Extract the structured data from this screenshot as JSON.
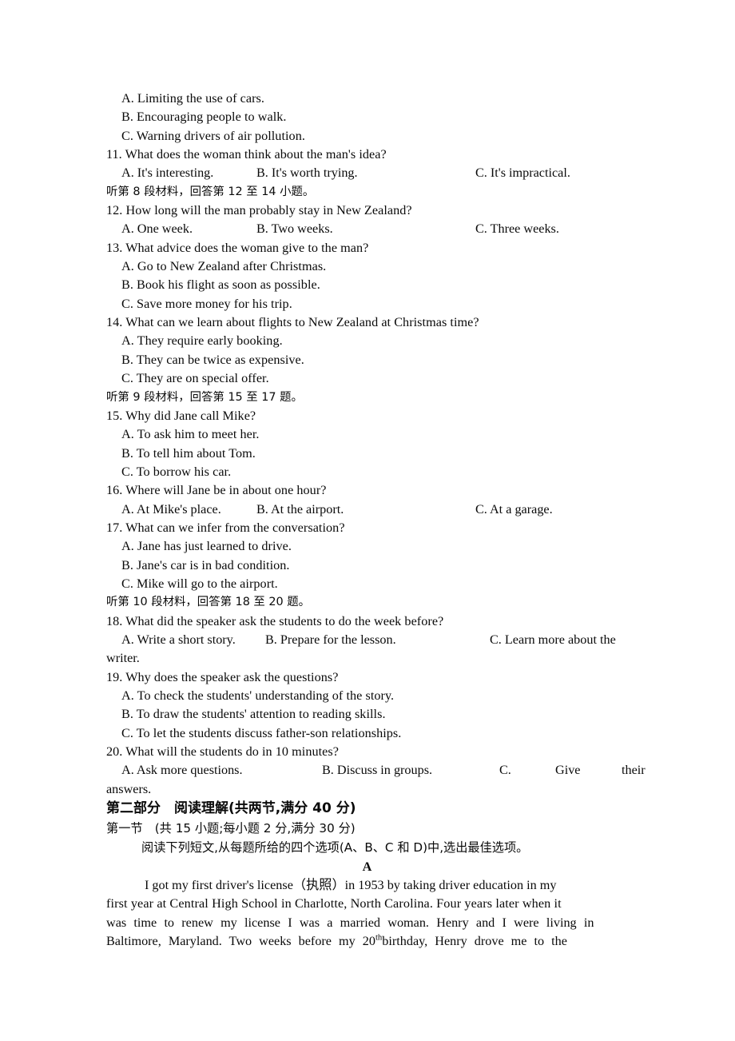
{
  "document": {
    "type": "exam-paper",
    "language": "en-zh",
    "section_heading": "第二部分　阅读理解(共两节,满分 40 分)",
    "subsection_heading": "第一节　(共 15 小题;每小题 2 分,满分 30 分)",
    "subsection_instruction": "阅读下列短文,从每题所给的四个选项(A、B、C 和 D)中,选出最佳选项。",
    "passage_letter": "A"
  },
  "orphan_options": [
    "A. Limiting the use of cars.",
    "B. Encouraging people to walk.",
    "C. Warning drivers of air pollution."
  ],
  "directives": {
    "d8": "听第 8 段材料，回答第 12 至 14 小题。",
    "d9": "听第 9 段材料，回答第 15 至 17 题。",
    "d10": "听第 10 段材料，回答第 18 至 20 题。"
  },
  "questions": [
    {
      "number": "11.",
      "stem": "11. What does the woman think about the man's idea?",
      "layout": "inline3",
      "options": [
        "A. It's interesting.",
        "B. It's worth trying.",
        "C. It's impractical."
      ]
    },
    {
      "number": "12.",
      "stem": "12. How long will the man probably stay in New Zealand?",
      "layout": "inline3",
      "options": [
        "A. One week.",
        "B. Two weeks.",
        "C. Three weeks."
      ]
    },
    {
      "number": "13.",
      "stem": "13. What advice does the woman give to the man?",
      "layout": "stacked",
      "options": [
        "A. Go to New Zealand after Christmas.",
        "B. Book his flight as soon as possible.",
        "C. Save more money for his trip."
      ]
    },
    {
      "number": "14.",
      "stem": "14. What can we learn about flights to New Zealand at Christmas time?",
      "layout": "stacked",
      "options": [
        "A. They require early booking.",
        "B. They can be twice as expensive.",
        "C. They are on special offer."
      ]
    },
    {
      "number": "15.",
      "stem": "15. Why did Jane call Mike?",
      "layout": "stacked",
      "options": [
        "A. To ask him to meet her.",
        "B. To tell him about Tom.",
        "C. To borrow his car."
      ]
    },
    {
      "number": "16.",
      "stem": "16. Where will Jane be in about one hour?",
      "layout": "inline3",
      "options": [
        "A. At Mike's place.",
        "B. At the airport.",
        "C. At a garage."
      ]
    },
    {
      "number": "17.",
      "stem": "17. What can we infer from the conversation?",
      "layout": "stacked",
      "options": [
        "A. Jane has just learned to drive.",
        "B. Jane's car is in bad condition.",
        "C. Mike will go to the airport."
      ]
    },
    {
      "number": "18.",
      "stem": "18. What did the speaker ask the students to do the week before?",
      "layout": "inline3wrap",
      "options": [
        "A. Write a short story.",
        "B. Prepare for the lesson.",
        "C. Learn more about the"
      ],
      "wrap": "writer."
    },
    {
      "number": "19.",
      "stem": "19. Why does the speaker ask the questions?",
      "layout": "stacked",
      "options": [
        "A. To check the students' understanding of the story.",
        "B. To draw the students' attention to reading skills.",
        "C. To let the students discuss father-son relationships."
      ]
    },
    {
      "number": "20.",
      "stem": "20. What will the students do in 10 minutes?",
      "layout": "justified3",
      "options": [
        "A. Ask more questions.",
        "B. Discuss in groups.",
        "C.",
        "Give",
        "their"
      ],
      "wrap": "answers."
    }
  ],
  "passage": {
    "lines": [
      "I got my first driver's license（执照）in 1953 by taking driver education in my",
      "first year at Central High School in Charlotte, North Carolina. Four years later when it",
      "was time to renew my license I was a married woman. Henry and I were living in",
      "Baltimore, Maryland. Two weeks before my 20"
    ],
    "line4_sup": "th",
    "line4_rest": " birthday, Henry drove me to the",
    "full_text": "I got my first driver's license（执照）in 1953 by taking driver education in my first year at Central High School in Charlotte, North Carolina. Four years later when it was time to renew my license I was a married woman. Henry and I were living in Baltimore, Maryland. Two weeks before my 20th birthday, Henry drove me to the"
  }
}
